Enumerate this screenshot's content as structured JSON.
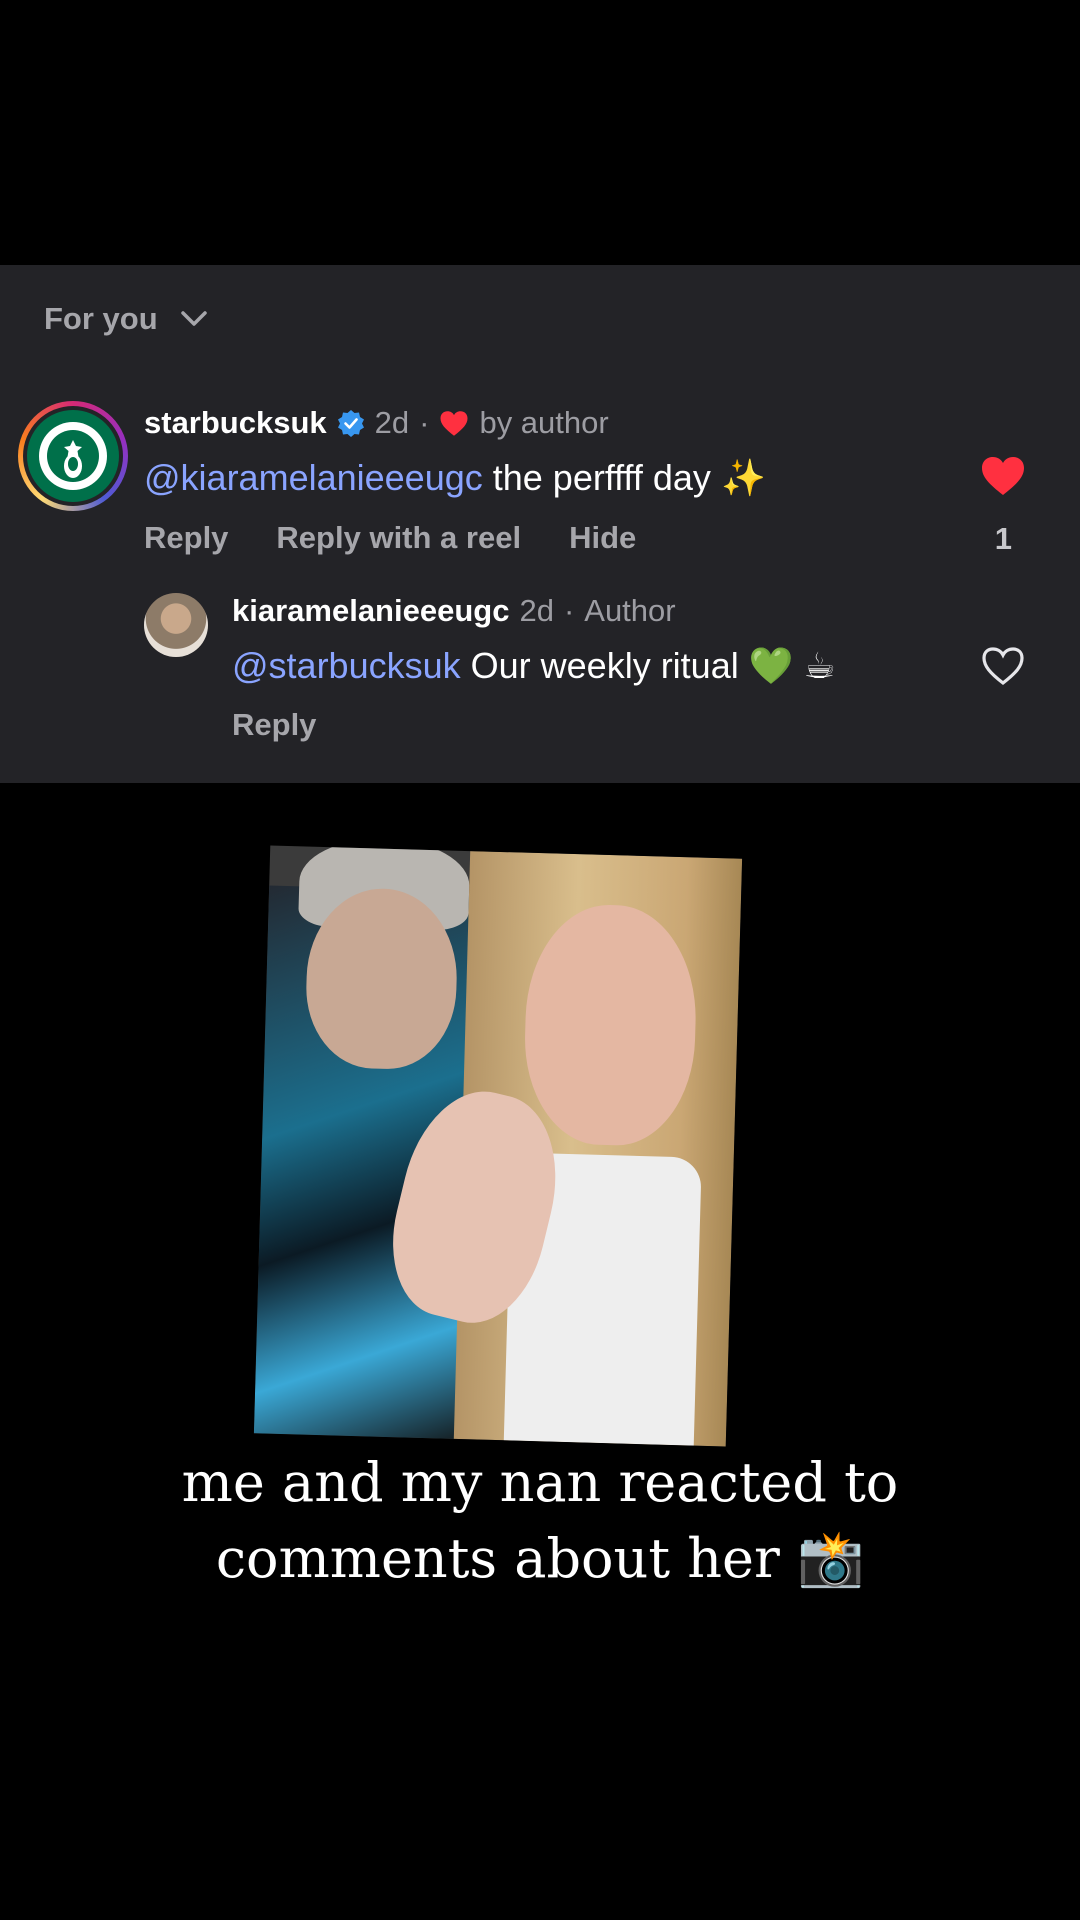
{
  "sort": {
    "label": "For you"
  },
  "comment": {
    "username": "starbucksuk",
    "age": "2d",
    "separator": "·",
    "liked_by": "by author",
    "mention": "@kiaramelanieeeugc",
    "text": "the perffff day",
    "emoji": "✨",
    "actions": {
      "reply": "Reply",
      "reply_reel": "Reply with a reel",
      "hide": "Hide"
    },
    "like_count": "1"
  },
  "reply": {
    "username": "kiaramelanieeeugc",
    "age": "2d",
    "separator": "·",
    "role": "Author",
    "mention": "@starbucksuk",
    "text": "Our weekly ritual",
    "emoji": "💚 ☕",
    "action": "Reply"
  },
  "caption": {
    "line1": "me and my nan reacted to",
    "line2": "comments about her",
    "emoji": "📸"
  },
  "colors": {
    "panel_bg": "#232327",
    "mention": "#8aa4ff",
    "starbucks_green": "#00704a",
    "heart_red": "#ff3040",
    "verified_blue": "#3897f0"
  }
}
